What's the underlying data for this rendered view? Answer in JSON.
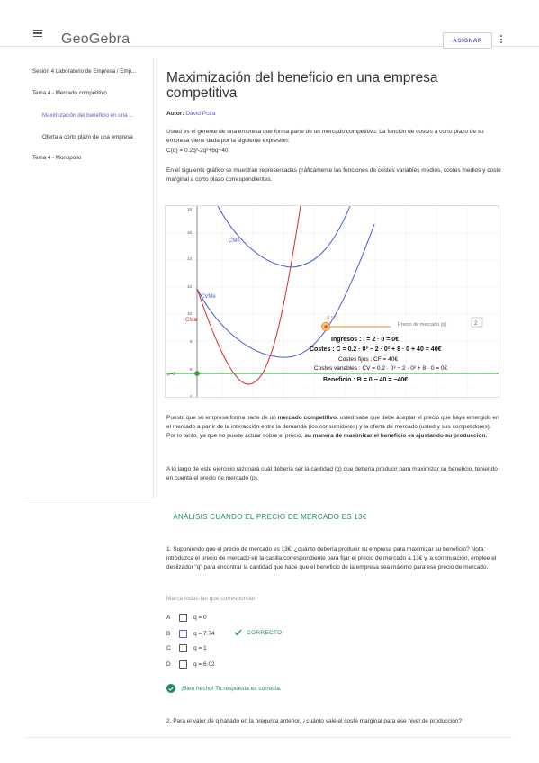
{
  "header": {
    "logo": "GeoGebra",
    "assign_label": "ASIGNAR"
  },
  "sidebar": {
    "items": [
      {
        "label": "Sesión 4 Laboratorio de Empresa / Emp..."
      },
      {
        "label": "Tema 4 - Mercado competitivo"
      },
      {
        "label": "Maximización del beneficio en una ..."
      },
      {
        "label": "Oferta a corto plazo de una empresa"
      },
      {
        "label": "Tema 4 - Monopolio"
      }
    ]
  },
  "main": {
    "title": "Maximización del beneficio en una empresa competitiva",
    "author_label": "Autor:",
    "author_name": "David Poza",
    "intro": "Usted es el gerente de una empresa que forma parte de un mercado competitivo. La función de costes a corto plazo de su empresa viene dada por la siguiente expresión:",
    "formula": "C(q) = 0.2q³-2q²+8q+40",
    "graph_intro": "En el siguiente gráfico se muestran representadas gráficamente las funciones de costes variables medios, costes medios y coste marginal a corto plazo correspondientes.",
    "para2_a": "Puesto que su empresa forma parte de un ",
    "para2_b": "mercado competitivo",
    "para2_c": ", usted sabe que debe aceptar el precio que haya emergido en el mercado a partir de la interacción entre la demanda (los consumidores) y la oferta de mercado (usted y sus competidores). Por lo tanto, ya que no puede actuar sobre el precio, ",
    "para2_d": "su manera de maximizar el beneficio es ajustando su producción.",
    "para3": "A lo largo de este ejercicio razonará cuál debería ser la cantidad (q) que debería producir para maximizar su beneficio, teniendo en cuenta el precio de mercado (p).",
    "section_heading": "ANÁLISIS CUANDO EL PRECIO DE MERCADO ES 13€",
    "question1": "1. Suponiendo que el precio de mercado es 13€, ¿cuánto debería producir su empresa para maximizar su beneficio? Nota: introduzca el precio de mercado en la casilla correspondiente para fijar el precio de mercado a 13€ y, a continuación, emplee el deslizador \"q\" para encontrar la cantidad que hace que el beneficio de la empresa sea máximo para ese precio de mercado.",
    "mark_all": "Marca todas las que correspondan",
    "options": [
      {
        "letter": "A",
        "text": "q = 0"
      },
      {
        "letter": "B",
        "text": "q = 7.74"
      },
      {
        "letter": "C",
        "text": "q = 1"
      },
      {
        "letter": "D",
        "text": "q = 6.02"
      }
    ],
    "correct_label": "CORRECTO",
    "feedback": "¡Bien hecho! Tu respuesta es correcta.",
    "question2": "2. Para el valor de q hallado en la pregunta anterior, ¿cuánto vale el coste marginal para ese nivel de producción?"
  },
  "applet": {
    "label_cme": "CMe",
    "label_cvme": "CVMe",
    "label_cma": "CMa",
    "label_q": "q = 0",
    "label_price": "Precio de mercado (p)",
    "price_value": "2",
    "label_p": "p=2",
    "ingresos": "Ingresos : I = 2 · 0 = 0€",
    "costes": "Costes : C = 0.2 · 0³ − 2 · 0² + 8 · 0 + 40 = 40€",
    "costes_fijos": "Costes fijos : CF = 40€",
    "costes_variables": "Costes variables : CV = 0.2 · 0³ − 2 · 0² + 8 · 0 = 0€",
    "beneficio": "Beneficio : B = 0 − 40 = −40€",
    "y_ticks": [
      "18",
      "16",
      "14",
      "12",
      "10",
      "8",
      "6",
      "4"
    ]
  },
  "colors": {
    "accent": "#6557d2",
    "success": "#218d5c"
  }
}
